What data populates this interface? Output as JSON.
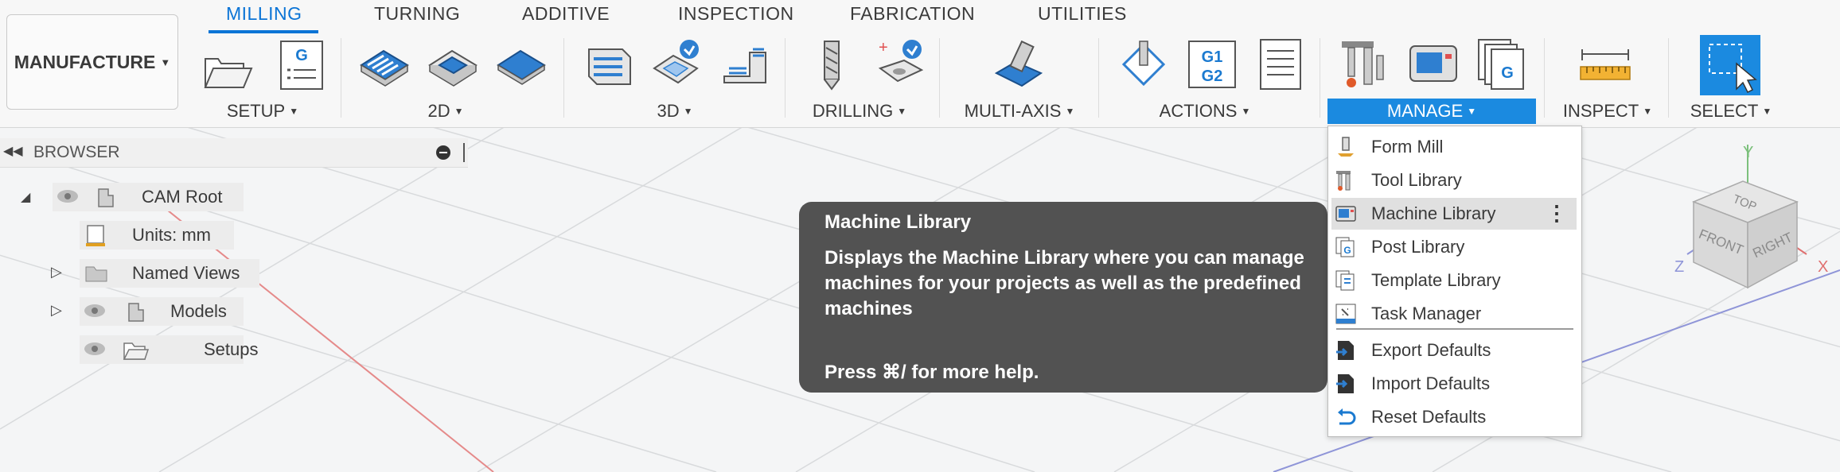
{
  "workspace": {
    "label": "MANUFACTURE"
  },
  "tabs": [
    {
      "label": "MILLING"
    },
    {
      "label": "TURNING"
    },
    {
      "label": "ADDITIVE"
    },
    {
      "label": "INSPECTION"
    },
    {
      "label": "FABRICATION"
    },
    {
      "label": "UTILITIES"
    }
  ],
  "groups": {
    "setup": "SETUP",
    "g2d": "2D",
    "g3d": "3D",
    "drilling": "DRILLING",
    "multiaxis": "MULTI-AXIS",
    "actions": "ACTIONS",
    "manage": "MANAGE",
    "inspect": "INSPECT",
    "select": "SELECT"
  },
  "icon_text": {
    "g_code": "G",
    "g1": "G1",
    "g2": "G2",
    "plus": "+"
  },
  "browser": {
    "title": "BROWSER",
    "items": [
      {
        "label": "CAM Root"
      },
      {
        "label": "Units: mm"
      },
      {
        "label": "Named Views"
      },
      {
        "label": "Models"
      },
      {
        "label": "Setups"
      }
    ]
  },
  "tooltip": {
    "title": "Machine Library",
    "body": "Displays the Machine Library where you can manage machines for your projects as well as the predefined machines",
    "help": "Press ⌘/ for more help."
  },
  "manage_menu": {
    "items": [
      {
        "label": "Form Mill",
        "icon": "form-mill-icon"
      },
      {
        "label": "Tool Library",
        "icon": "tool-library-icon"
      },
      {
        "label": "Machine Library",
        "icon": "machine-library-icon",
        "highlighted": true
      },
      {
        "label": "Post Library",
        "icon": "post-library-icon"
      },
      {
        "label": "Template Library",
        "icon": "template-library-icon"
      },
      {
        "label": "Task Manager",
        "icon": "task-manager-icon"
      },
      {
        "label": "Export Defaults",
        "icon": "export-defaults-icon"
      },
      {
        "label": "Import Defaults",
        "icon": "import-defaults-icon"
      },
      {
        "label": "Reset Defaults",
        "icon": "reset-defaults-icon"
      }
    ]
  },
  "viewcube": {
    "top": "TOP",
    "front": "FRONT",
    "right": "RIGHT",
    "axis_x": "X",
    "axis_y": "Y",
    "axis_z": "Z"
  },
  "colors": {
    "accent": "#0b74d6",
    "manage_highlight": "#1b8ae0",
    "tooltip_bg": "#525252",
    "axis_x": "#e07070",
    "axis_y": "#7cc07c",
    "axis_z": "#7f86d6"
  }
}
